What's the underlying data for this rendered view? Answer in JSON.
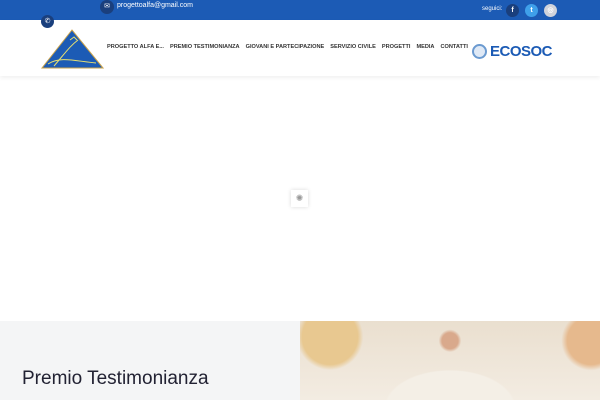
{
  "topbar": {
    "email": "progettoalfa@gmail.com",
    "follow_label": "seguici:",
    "social": [
      {
        "icon": "facebook-icon",
        "glyph": "f",
        "color": "#1a3f7d"
      },
      {
        "icon": "twitter-icon",
        "glyph": "t",
        "color": "#3fa0ea"
      },
      {
        "icon": "instagram-icon",
        "glyph": "◎",
        "color": "#d0d3db"
      }
    ]
  },
  "nav": {
    "items": [
      "PROGETTO ALFA E...",
      "PREMIO TESTIMONIANZA",
      "GIOVANI E PARTECIPAZIONE",
      "SERVIZIO CIVILE",
      "PROGETTI",
      "MEDIA",
      "CONTATTI"
    ]
  },
  "partner": {
    "name": "ECOSOC"
  },
  "section": {
    "title": "Premio Testimonianza"
  }
}
